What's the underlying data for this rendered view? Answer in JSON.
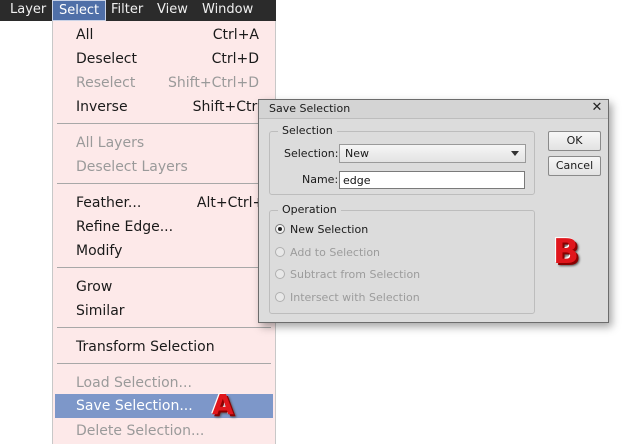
{
  "menubar": {
    "items": [
      {
        "label": "Layer",
        "active": false
      },
      {
        "label": "Select",
        "active": true
      },
      {
        "label": "Filter",
        "active": false
      },
      {
        "label": "View",
        "active": false
      },
      {
        "label": "Window",
        "active": false
      }
    ]
  },
  "select_menu": {
    "items": [
      {
        "label": "All",
        "shortcut": "Ctrl+A",
        "enabled": true
      },
      {
        "label": "Deselect",
        "shortcut": "Ctrl+D",
        "enabled": true
      },
      {
        "label": "Reselect",
        "shortcut": "Shift+Ctrl+D",
        "enabled": false
      },
      {
        "label": "Inverse",
        "shortcut": "Shift+Ctrl+I",
        "enabled": true
      },
      {
        "label": "All Layers",
        "shortcut": "",
        "enabled": false
      },
      {
        "label": "Deselect Layers",
        "shortcut": "",
        "enabled": false
      },
      {
        "label": "Feather...",
        "shortcut": "Alt+Ctrl+D",
        "enabled": true
      },
      {
        "label": "Refine Edge...",
        "shortcut": "",
        "enabled": true
      },
      {
        "label": "Modify",
        "shortcut": "",
        "enabled": true
      },
      {
        "label": "Grow",
        "shortcut": "",
        "enabled": true
      },
      {
        "label": "Similar",
        "shortcut": "",
        "enabled": true
      },
      {
        "label": "Transform Selection",
        "shortcut": "",
        "enabled": true
      },
      {
        "label": "Load Selection...",
        "shortcut": "",
        "enabled": false
      },
      {
        "label": "Save Selection...",
        "shortcut": "",
        "enabled": true,
        "highlighted": true
      },
      {
        "label": "Delete Selection...",
        "shortcut": "",
        "enabled": false
      }
    ]
  },
  "annotations": {
    "a": "A",
    "b": "B"
  },
  "dialog": {
    "title": "Save Selection",
    "close_glyph": "✕",
    "selection_group": {
      "title": "Selection",
      "selection_label": "Selection:",
      "selection_value": "New",
      "name_label": "Name:",
      "name_value": "edge"
    },
    "operation_group": {
      "title": "Operation",
      "options": [
        {
          "label": "New Selection",
          "selected": true,
          "enabled": true
        },
        {
          "label": "Add to Selection",
          "selected": false,
          "enabled": false
        },
        {
          "label": "Subtract from Selection",
          "selected": false,
          "enabled": false
        },
        {
          "label": "Intersect with Selection",
          "selected": false,
          "enabled": false
        }
      ]
    },
    "buttons": {
      "ok": "OK",
      "cancel": "Cancel"
    }
  },
  "colors": {
    "menubar_bg": "#2b2b2b",
    "menu_bg": "#fde9e9",
    "highlight": "#7d97c9",
    "dialog_bg": "#dcdcdc",
    "badge_red": "#e0161c"
  }
}
